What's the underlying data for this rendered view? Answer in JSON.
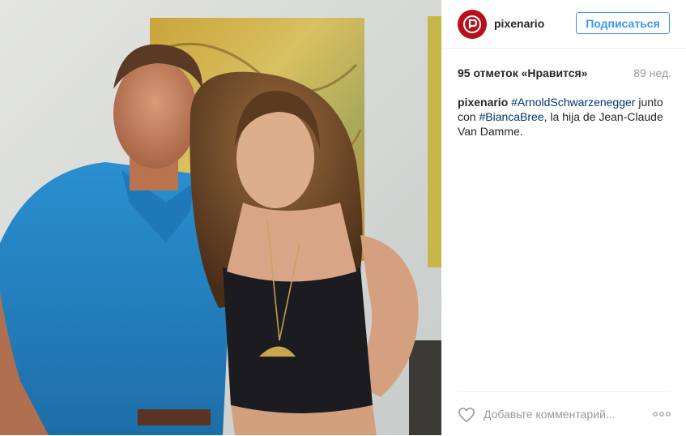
{
  "photo": {
    "alt": ""
  },
  "header": {
    "username": "pixenario",
    "follow_label": "Подписаться"
  },
  "stats": {
    "likes": "95 отметок «Нравится»",
    "age": "89 нед."
  },
  "caption": {
    "username": "pixenario",
    "hashtag_1": "#ArnoldSchwarzenegger",
    "text_1": " junto con ",
    "hashtag_2": "#BiancaBree",
    "text_2": ", la hija de Jean-Claude Van Damme."
  },
  "footer": {
    "comment_placeholder": "Добавьте комментарий...",
    "like_icon": "heart-icon",
    "more_icon": "more-options-icon"
  },
  "colors": {
    "accent": "#3897f0",
    "hashtag": "#003569",
    "brand": "#b80f1c"
  }
}
